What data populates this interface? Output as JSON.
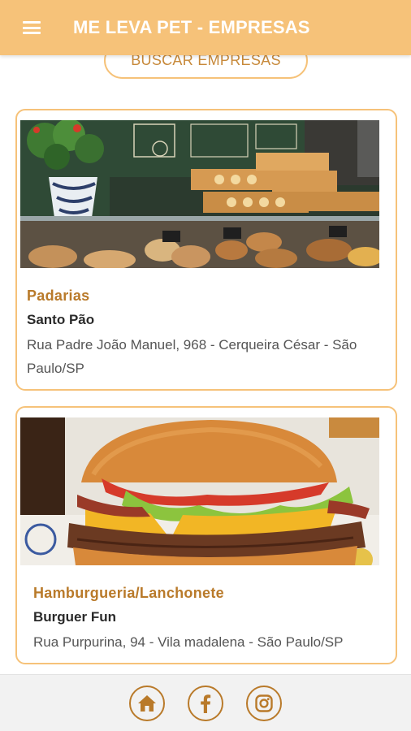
{
  "app_bar": {
    "title": "ME LEVA PET - EMPRESAS",
    "menu_icon": "hamburger-menu-icon"
  },
  "search": {
    "label": "BUSCAR EMPRESAS"
  },
  "companies": [
    {
      "category": "Padarias",
      "name": "Santo Pão",
      "address": "Rua Padre João Manuel, 968 - Cerqueira César - São Paulo/SP",
      "image": "bakery-display-photo"
    },
    {
      "category": "Hamburgueria/Lanchonete",
      "name": "Burguer Fun",
      "address": "Rua Purpurina, 94 - Vila madalena - São Paulo/SP",
      "image": "cheeseburger-photo"
    }
  ],
  "footer": {
    "icons": [
      "home-icon",
      "facebook-icon",
      "instagram-icon"
    ]
  },
  "colors": {
    "accent": "#f6c279",
    "category_text": "#b97a2a",
    "footer_bg": "#f2f2f2"
  }
}
